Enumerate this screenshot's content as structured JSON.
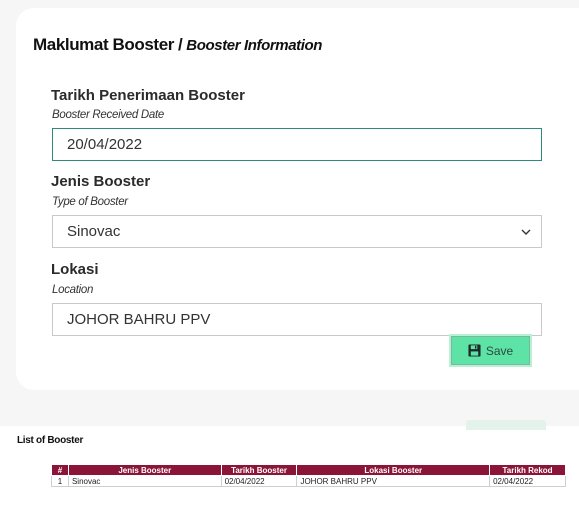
{
  "form": {
    "title_ms": "Maklumat Booster",
    "title_sep": "/",
    "title_en": "Booster Information",
    "received_date": {
      "label": "Tarikh Penerimaan Booster",
      "sub": "Booster Received Date",
      "value": "20/04/2022"
    },
    "booster_type": {
      "label": "Jenis Booster",
      "sub": "Type of Booster",
      "value": "Sinovac"
    },
    "location": {
      "label": "Lokasi",
      "sub": "Location",
      "value": "JOHOR BAHRU PPV"
    },
    "save_label": "Save",
    "save_icon": "floppy-disk-icon"
  },
  "list": {
    "title": "List of Booster",
    "columns": [
      "#",
      "Jenis Booster",
      "Tarikh Booster",
      "Lokasi Booster",
      "Tarikh Rekod"
    ],
    "rows": [
      [
        "1",
        "Sinovac",
        "02/04/2022",
        "JOHOR BAHRU PPV",
        "02/04/2022"
      ]
    ]
  },
  "colors": {
    "header_bg": "#8b1538",
    "save_bg": "#5de3a6",
    "focus_border": "#2e8b7a"
  }
}
